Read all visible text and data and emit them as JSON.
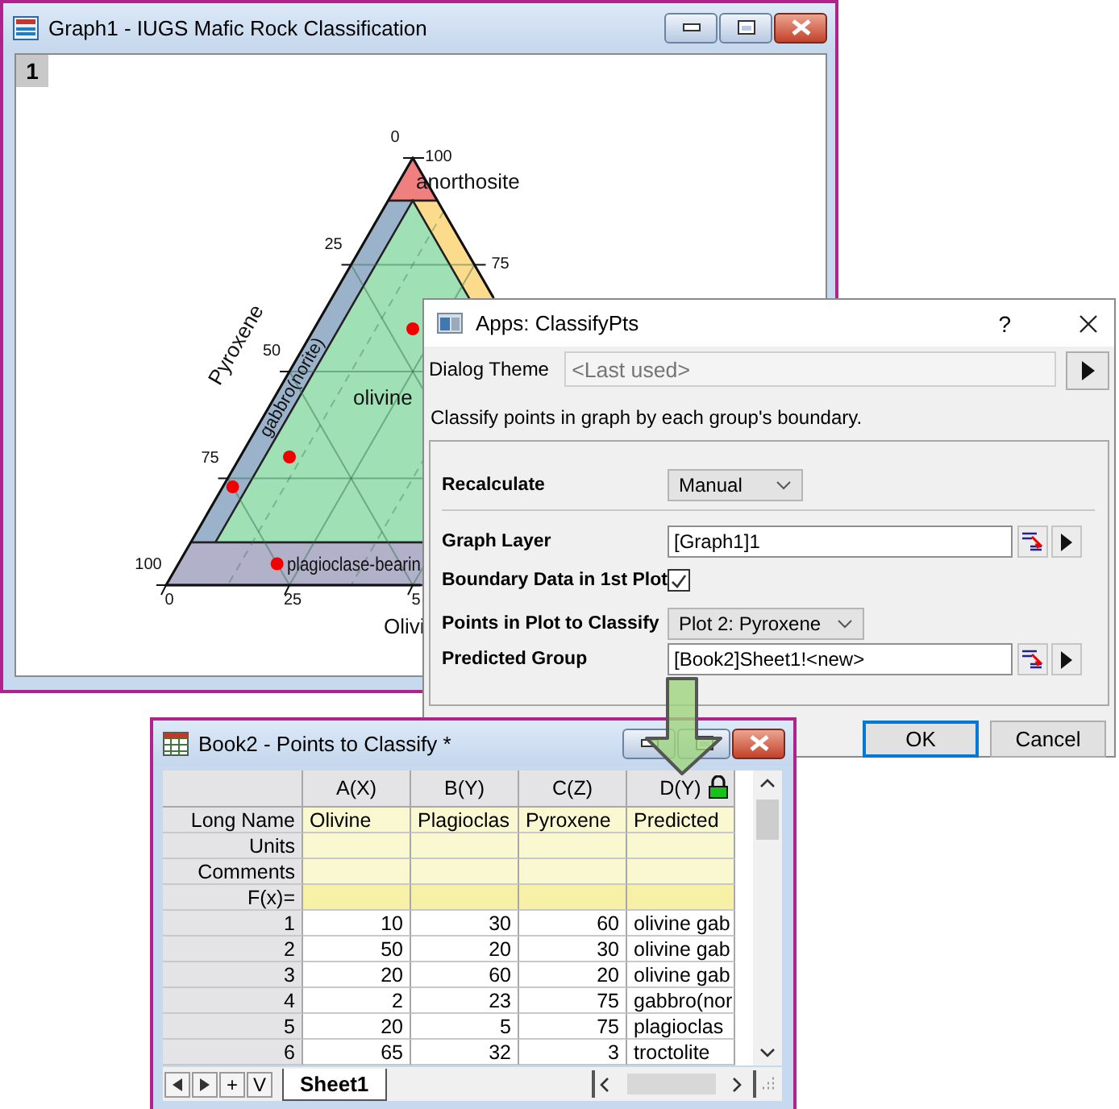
{
  "graph_window": {
    "title": "Graph1 - IUGS Mafic Rock Classification",
    "layer": "1",
    "ternary": {
      "axes": [
        {
          "kind": "left",
          "title": "Pyroxene",
          "ticks": [
            "0",
            "25",
            "50",
            "75",
            "100"
          ]
        },
        {
          "kind": "right",
          "ticks": [
            "100",
            "75"
          ]
        },
        {
          "kind": "bottom",
          "title": "Olivi",
          "ticks": [
            "0",
            "25",
            "5"
          ]
        }
      ],
      "regions": [
        {
          "kind": "apex",
          "label": "anorthosite",
          "color": "#f08080"
        },
        {
          "kind": "left_band",
          "label": "gabbro(norite)",
          "color": "#9bb2cb"
        },
        {
          "kind": "right_band",
          "color": "#fcdc8c"
        },
        {
          "kind": "center",
          "label": "olivine",
          "color": "#9fe0b5"
        },
        {
          "kind": "bottom_band",
          "label": "plagioclase-bearin",
          "color": "#b1b1c9"
        }
      ]
    }
  },
  "dialog": {
    "title": "Apps: ClassifyPts",
    "help": "?",
    "theme_label": "Dialog Theme",
    "theme_placeholder": "<Last used>",
    "description": "Classify points in graph by each group's boundary.",
    "fields": [
      {
        "kind": "dropdown",
        "label": "Recalculate",
        "value": "Manual"
      },
      {
        "kind": "separator"
      },
      {
        "kind": "picker",
        "label": "Graph Layer",
        "value": "[Graph1]1"
      },
      {
        "kind": "checkbox",
        "label": "Boundary Data in 1st Plot",
        "checked": true
      },
      {
        "kind": "dropdown",
        "label": "Points in Plot to Classify",
        "value": "Plot 2: Pyroxene"
      },
      {
        "kind": "picker",
        "label": "Predicted Group",
        "value": "[Book2]Sheet1!<new>"
      }
    ],
    "buttons": [
      {
        "label": "OK",
        "default": true
      },
      {
        "label": "Cancel",
        "default": false
      }
    ]
  },
  "book": {
    "title": "Book2 - Points to Classify *",
    "columns": [
      {
        "label": "A(X)",
        "locked": false
      },
      {
        "label": "B(Y)",
        "locked": false
      },
      {
        "label": "C(Z)",
        "locked": false
      },
      {
        "label": "D(Y)",
        "locked": true
      }
    ],
    "label_rows": [
      {
        "kind": "label",
        "label": "Long Name",
        "cells": [
          "Olivine",
          "Plagioclas",
          "Pyroxene",
          "Predicted"
        ]
      },
      {
        "kind": "label",
        "label": "Units"
      },
      {
        "kind": "label",
        "label": "Comments"
      },
      {
        "kind": "formula",
        "label": "F(x)="
      }
    ],
    "rows": [
      {
        "index": "1",
        "cells": [
          "10",
          "30",
          "60",
          "olivine gab"
        ]
      },
      {
        "index": "2",
        "cells": [
          "50",
          "20",
          "30",
          "olivine gab"
        ]
      },
      {
        "index": "3",
        "cells": [
          "20",
          "60",
          "20",
          "olivine gab"
        ]
      },
      {
        "index": "4",
        "cells": [
          "2",
          "23",
          "75",
          "gabbro(nor"
        ]
      },
      {
        "index": "5",
        "cells": [
          "20",
          "5",
          "75",
          "plagioclas"
        ]
      },
      {
        "index": "6",
        "cells": [
          "65",
          "32",
          "3",
          "troctolite"
        ]
      }
    ],
    "nav_buttons": [
      "+",
      "V"
    ],
    "sheets": [
      {
        "label": "Sheet1",
        "selected": true
      }
    ]
  }
}
